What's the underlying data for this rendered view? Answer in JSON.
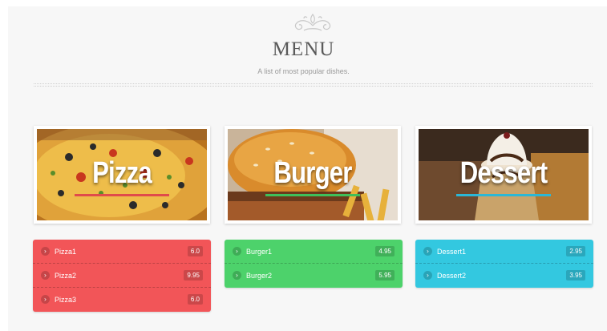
{
  "header": {
    "title": "MENU",
    "subtitle": "A list of most popular dishes."
  },
  "colors": {
    "pizza": "#f25558",
    "burger": "#4dd26b",
    "dessert": "#33c8e0",
    "pizza_line": "#e04b4b",
    "burger_line": "#3fbf5a",
    "dessert_line": "#2bb7d6"
  },
  "categories": [
    {
      "label": "Pizza",
      "items": [
        {
          "name": "Pizza1",
          "price": "6.0"
        },
        {
          "name": "Pizza2",
          "price": "9.95"
        },
        {
          "name": "Pizza3",
          "price": "6.0"
        }
      ]
    },
    {
      "label": "Burger",
      "items": [
        {
          "name": "Burger1",
          "price": "4.95"
        },
        {
          "name": "Burger2",
          "price": "5.95"
        }
      ]
    },
    {
      "label": "Dessert",
      "items": [
        {
          "name": "Dessert1",
          "price": "2.95"
        },
        {
          "name": "Dessert2",
          "price": "3.95"
        }
      ]
    }
  ]
}
